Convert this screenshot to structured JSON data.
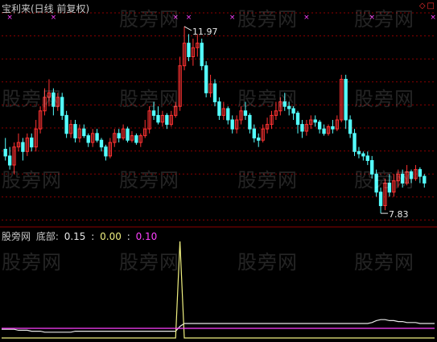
{
  "header": {
    "title": "宝利来(日线 前复权)"
  },
  "indicator": {
    "source": "股旁网",
    "name": "底部:",
    "values": [
      "0.15",
      "0.00",
      "0.10"
    ],
    "separator": ":"
  },
  "watermark": "股旁网",
  "colors": {
    "up": "#ff3232",
    "down": "#54ffff",
    "grid": "#8b0000",
    "line_white": "#e8e8e8",
    "line_yellow": "#f0f080",
    "line_magenta": "#ff40ff",
    "signal": "#ff40ff"
  },
  "chart_data": [
    {
      "type": "candlestick",
      "title": "宝利来(日线 前复权)",
      "annotations": [
        {
          "label": "11.97",
          "value": 11.97,
          "kind": "max"
        },
        {
          "label": "7.83",
          "value": 7.83,
          "kind": "min"
        }
      ],
      "ylim": [
        7.6,
        12.2
      ],
      "grid": true,
      "candles": [
        [
          9.25,
          9.1,
          9.5,
          9.0
        ],
        [
          9.1,
          8.9,
          9.3,
          8.8
        ],
        [
          8.9,
          9.3,
          9.4,
          8.7
        ],
        [
          9.3,
          9.4,
          9.6,
          9.2
        ],
        [
          9.4,
          9.2,
          9.5,
          9.0
        ],
        [
          9.2,
          9.5,
          9.6,
          9.1
        ],
        [
          9.5,
          9.3,
          9.6,
          9.2
        ],
        [
          9.3,
          9.7,
          9.9,
          9.2
        ],
        [
          9.7,
          10.1,
          10.2,
          9.6
        ],
        [
          10.1,
          10.4,
          10.6,
          10.0
        ],
        [
          10.4,
          10.5,
          10.8,
          10.2
        ],
        [
          10.5,
          10.2,
          10.6,
          10.0
        ],
        [
          10.2,
          10.4,
          10.5,
          10.1
        ],
        [
          10.4,
          10.0,
          10.5,
          9.9
        ],
        [
          10.0,
          9.6,
          10.1,
          9.5
        ],
        [
          9.6,
          9.8,
          9.9,
          9.5
        ],
        [
          9.8,
          9.5,
          9.9,
          9.4
        ],
        [
          9.5,
          9.7,
          9.8,
          9.4
        ],
        [
          9.7,
          9.55,
          9.8,
          9.5
        ],
        [
          9.55,
          9.4,
          9.6,
          9.3
        ],
        [
          9.4,
          9.6,
          9.7,
          9.3
        ],
        [
          9.6,
          9.45,
          9.7,
          9.4
        ],
        [
          9.45,
          9.3,
          9.5,
          9.2
        ],
        [
          9.3,
          9.1,
          9.35,
          9.0
        ],
        [
          9.1,
          9.4,
          9.5,
          9.05
        ],
        [
          9.4,
          9.6,
          9.7,
          9.3
        ],
        [
          9.6,
          9.5,
          9.7,
          9.4
        ],
        [
          9.5,
          9.7,
          9.8,
          9.45
        ],
        [
          9.7,
          9.45,
          9.75,
          9.4
        ],
        [
          9.45,
          9.55,
          9.65,
          9.4
        ],
        [
          9.55,
          9.4,
          9.6,
          9.35
        ],
        [
          9.4,
          9.55,
          9.6,
          9.3
        ],
        [
          9.55,
          9.7,
          9.9,
          9.5
        ],
        [
          9.7,
          10.1,
          10.2,
          9.6
        ],
        [
          10.1,
          10.0,
          10.3,
          9.9
        ],
        [
          10.0,
          9.85,
          10.2,
          9.8
        ],
        [
          9.85,
          10.0,
          10.1,
          9.75
        ],
        [
          10.0,
          9.8,
          10.05,
          9.7
        ],
        [
          9.8,
          10.0,
          10.1,
          9.75
        ],
        [
          10.0,
          10.2,
          10.3,
          9.95
        ],
        [
          10.2,
          11.1,
          11.3,
          10.1
        ],
        [
          11.1,
          11.6,
          11.97,
          11.0
        ],
        [
          11.6,
          11.3,
          11.8,
          11.2
        ],
        [
          11.3,
          11.5,
          11.7,
          11.1
        ],
        [
          11.5,
          11.6,
          11.8,
          11.3
        ],
        [
          11.6,
          11.1,
          11.7,
          11.0
        ],
        [
          11.1,
          10.5,
          11.2,
          10.4
        ],
        [
          10.5,
          10.7,
          10.9,
          10.4
        ],
        [
          10.7,
          10.3,
          10.8,
          10.2
        ],
        [
          10.3,
          10.0,
          10.4,
          9.9
        ],
        [
          10.0,
          10.15,
          10.3,
          9.9
        ],
        [
          10.15,
          9.9,
          10.2,
          9.8
        ],
        [
          9.9,
          9.7,
          10.0,
          9.6
        ],
        [
          9.7,
          9.9,
          10.0,
          9.6
        ],
        [
          9.9,
          10.1,
          10.2,
          9.8
        ],
        [
          10.1,
          10.0,
          10.3,
          9.9
        ],
        [
          10.0,
          9.7,
          10.05,
          9.6
        ],
        [
          9.7,
          9.5,
          9.8,
          9.4
        ],
        [
          9.5,
          9.45,
          9.6,
          9.3
        ],
        [
          9.45,
          9.7,
          9.8,
          9.4
        ],
        [
          9.7,
          9.8,
          9.95,
          9.6
        ],
        [
          9.8,
          10.0,
          10.1,
          9.7
        ],
        [
          10.0,
          10.1,
          10.3,
          9.9
        ],
        [
          10.1,
          10.3,
          10.4,
          10.0
        ],
        [
          10.3,
          10.2,
          10.5,
          10.1
        ],
        [
          10.2,
          10.15,
          10.3,
          10.0
        ],
        [
          10.15,
          10.05,
          10.2,
          9.9
        ],
        [
          10.05,
          9.8,
          10.1,
          9.6
        ],
        [
          9.8,
          9.65,
          9.9,
          9.5
        ],
        [
          9.65,
          9.8,
          9.9,
          9.55
        ],
        [
          9.8,
          9.9,
          10.0,
          9.7
        ],
        [
          9.9,
          9.85,
          10.0,
          9.75
        ],
        [
          9.85,
          9.7,
          9.9,
          9.6
        ],
        [
          9.7,
          9.6,
          9.8,
          9.55
        ],
        [
          9.6,
          9.75,
          9.8,
          9.55
        ],
        [
          9.75,
          9.7,
          9.9,
          9.6
        ],
        [
          9.7,
          9.9,
          10.0,
          9.65
        ],
        [
          9.9,
          10.8,
          10.9,
          9.85
        ],
        [
          10.8,
          9.9,
          10.9,
          9.7
        ],
        [
          9.9,
          9.6,
          10.0,
          9.5
        ],
        [
          9.6,
          9.2,
          9.7,
          9.1
        ],
        [
          9.2,
          9.15,
          9.3,
          9.05
        ],
        [
          9.15,
          9.1,
          9.2,
          9.0
        ],
        [
          9.1,
          9.0,
          9.2,
          8.9
        ],
        [
          9.0,
          8.7,
          9.1,
          8.6
        ],
        [
          8.7,
          8.3,
          8.8,
          8.2
        ],
        [
          8.3,
          8.0,
          8.4,
          7.83
        ],
        [
          8.0,
          8.5,
          8.6,
          7.9
        ],
        [
          8.5,
          8.3,
          8.7,
          8.2
        ],
        [
          8.3,
          8.55,
          8.7,
          8.2
        ],
        [
          8.55,
          8.7,
          8.8,
          8.4
        ],
        [
          8.7,
          8.5,
          8.8,
          8.4
        ],
        [
          8.5,
          8.75,
          8.9,
          8.45
        ],
        [
          8.75,
          8.6,
          8.8,
          8.5
        ],
        [
          8.6,
          8.8,
          8.9,
          8.55
        ],
        [
          8.8,
          8.65,
          8.85,
          8.5
        ],
        [
          8.65,
          8.5,
          8.7,
          8.4
        ]
      ],
      "signal_marks": [
        1,
        11,
        39,
        42,
        52,
        69,
        84,
        98
      ]
    },
    {
      "type": "line",
      "name": "底部",
      "ylim": [
        0,
        1.0
      ],
      "grid": false,
      "series": [
        {
          "name": "white",
          "color": "#e8e8e8",
          "values": [
            0.09,
            0.09,
            0.09,
            0.08,
            0.08,
            0.08,
            0.07,
            0.07,
            0.07,
            0.06,
            0.06,
            0.06,
            0.06,
            0.06,
            0.06,
            0.06,
            0.07,
            0.07,
            0.07,
            0.07,
            0.07,
            0.07,
            0.07,
            0.07,
            0.07,
            0.07,
            0.07,
            0.07,
            0.07,
            0.07,
            0.07,
            0.07,
            0.07,
            0.07,
            0.07,
            0.07,
            0.07,
            0.07,
            0.07,
            0.07,
            0.12,
            0.15,
            0.15,
            0.15,
            0.15,
            0.15,
            0.15,
            0.15,
            0.15,
            0.15,
            0.15,
            0.15,
            0.15,
            0.15,
            0.15,
            0.15,
            0.15,
            0.15,
            0.15,
            0.15,
            0.15,
            0.15,
            0.15,
            0.15,
            0.15,
            0.15,
            0.15,
            0.15,
            0.15,
            0.15,
            0.15,
            0.15,
            0.15,
            0.15,
            0.15,
            0.15,
            0.15,
            0.15,
            0.15,
            0.15,
            0.15,
            0.15,
            0.15,
            0.15,
            0.16,
            0.18,
            0.19,
            0.19,
            0.18,
            0.18,
            0.17,
            0.17,
            0.16,
            0.16,
            0.16,
            0.15,
            0.15
          ]
        },
        {
          "name": "yellow",
          "color": "#f0f080",
          "values": [
            0.0,
            0.0,
            0.0,
            0.0,
            0.0,
            0.0,
            0.0,
            0.0,
            0.0,
            0.0,
            0.0,
            0.0,
            0.0,
            0.0,
            0.0,
            0.0,
            0.0,
            0.0,
            0.0,
            0.0,
            0.0,
            0.0,
            0.0,
            0.0,
            0.0,
            0.0,
            0.0,
            0.0,
            0.0,
            0.0,
            0.0,
            0.0,
            0.0,
            0.0,
            0.0,
            0.0,
            0.0,
            0.0,
            0.0,
            0.0,
            1.0,
            0.0,
            0.0,
            0.0,
            0.0,
            0.0,
            0.0,
            0.0,
            0.0,
            0.0,
            0.0,
            0.0,
            0.0,
            0.0,
            0.0,
            0.0,
            0.0,
            0.0,
            0.0,
            0.0,
            0.0,
            0.0,
            0.0,
            0.0,
            0.0,
            0.0,
            0.0,
            0.0,
            0.0,
            0.0,
            0.0,
            0.0,
            0.0,
            0.0,
            0.0,
            0.0,
            0.0,
            0.0,
            0.0,
            0.0,
            0.0,
            0.0,
            0.0,
            0.0,
            0.0,
            0.0,
            0.0,
            0.0,
            0.0,
            0.0,
            0.0,
            0.0,
            0.0,
            0.0,
            0.0,
            0.0,
            0.0
          ]
        },
        {
          "name": "magenta",
          "color": "#ff40ff",
          "values": [
            0.1,
            0.1,
            0.1,
            0.1,
            0.1,
            0.1,
            0.1,
            0.1,
            0.1,
            0.1,
            0.1,
            0.1,
            0.1,
            0.1,
            0.1,
            0.1,
            0.1,
            0.1,
            0.1,
            0.1,
            0.1,
            0.1,
            0.1,
            0.1,
            0.1,
            0.1,
            0.1,
            0.1,
            0.1,
            0.1,
            0.1,
            0.1,
            0.1,
            0.1,
            0.1,
            0.1,
            0.1,
            0.1,
            0.1,
            0.1,
            0.1,
            0.1,
            0.1,
            0.1,
            0.1,
            0.1,
            0.1,
            0.1,
            0.1,
            0.1,
            0.1,
            0.1,
            0.1,
            0.1,
            0.1,
            0.1,
            0.1,
            0.1,
            0.1,
            0.1,
            0.1,
            0.1,
            0.1,
            0.1,
            0.1,
            0.1,
            0.1,
            0.1,
            0.1,
            0.1,
            0.1,
            0.1,
            0.1,
            0.1,
            0.1,
            0.1,
            0.1,
            0.1,
            0.1,
            0.1,
            0.1,
            0.1,
            0.1,
            0.1,
            0.1,
            0.1,
            0.1,
            0.1,
            0.1,
            0.1,
            0.1,
            0.1,
            0.1,
            0.1,
            0.1,
            0.1,
            0.1
          ]
        }
      ]
    }
  ]
}
